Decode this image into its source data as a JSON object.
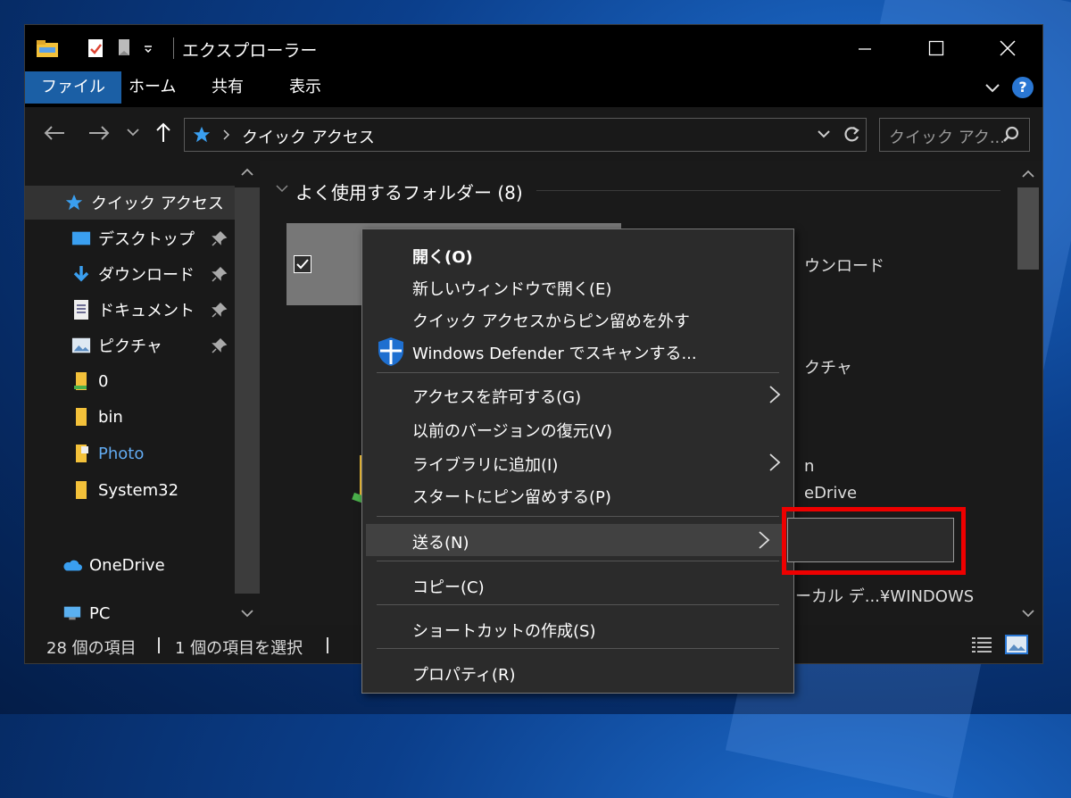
{
  "window": {
    "title": "エクスプローラー",
    "controls": {
      "minimize": "—",
      "maximize": "☐",
      "close": "✕"
    }
  },
  "ribbon": {
    "tabs": [
      "ファイル",
      "ホーム",
      "共有",
      "表示"
    ],
    "help": "?"
  },
  "address": {
    "path": "クイック アクセス",
    "search_placeholder": "クイック アク..."
  },
  "nav": {
    "items": [
      {
        "label": "クイック アクセス",
        "icon": "star-icon"
      },
      {
        "label": "デスクトップ",
        "icon": "desktop-icon"
      },
      {
        "label": "ダウンロード",
        "icon": "download-icon"
      },
      {
        "label": "ドキュメント",
        "icon": "document-icon"
      },
      {
        "label": "ピクチャ",
        "icon": "picture-icon"
      },
      {
        "label": "0",
        "icon": "folder-icon"
      },
      {
        "label": "bin",
        "icon": "folder-icon"
      },
      {
        "label": "Photo",
        "icon": "folder-icon"
      },
      {
        "label": "System32",
        "icon": "folder-icon"
      },
      {
        "label": "OneDrive",
        "icon": "cloud-icon"
      },
      {
        "label": "PC",
        "icon": "pc-icon"
      }
    ]
  },
  "content": {
    "group_title": "よく使用するフォルダー (8)",
    "partial_labels": [
      "ウンロード",
      "クチャ",
      "n",
      "eDrive",
      "ーカル デ...¥WINDOWS"
    ]
  },
  "status": {
    "count": "28 個の項目",
    "selected": "1 個の項目を選択"
  },
  "context_menu": {
    "items": [
      {
        "label": "開く(O)",
        "bold": true
      },
      {
        "label": "新しいウィンドウで開く(E)"
      },
      {
        "label": "クイック アクセスからピン留めを外す"
      },
      {
        "label": "Windows Defender でスキャンする..."
      },
      {
        "label": "アクセスを許可する(G)",
        "submenu": true
      },
      {
        "label": "以前のバージョンの復元(V)"
      },
      {
        "label": "ライブラリに追加(I)",
        "submenu": true
      },
      {
        "label": "スタートにピン留めする(P)"
      },
      {
        "label": "送る(N)",
        "submenu": true,
        "highlighted": true
      },
      {
        "label": "コピー(C)"
      },
      {
        "label": "ショートカットの作成(S)"
      },
      {
        "label": "プロパティ(R)"
      }
    ]
  },
  "colors": {
    "accent": "#1b5fa5",
    "highlight_box": "#e00000",
    "folder": "#f3c13a"
  }
}
